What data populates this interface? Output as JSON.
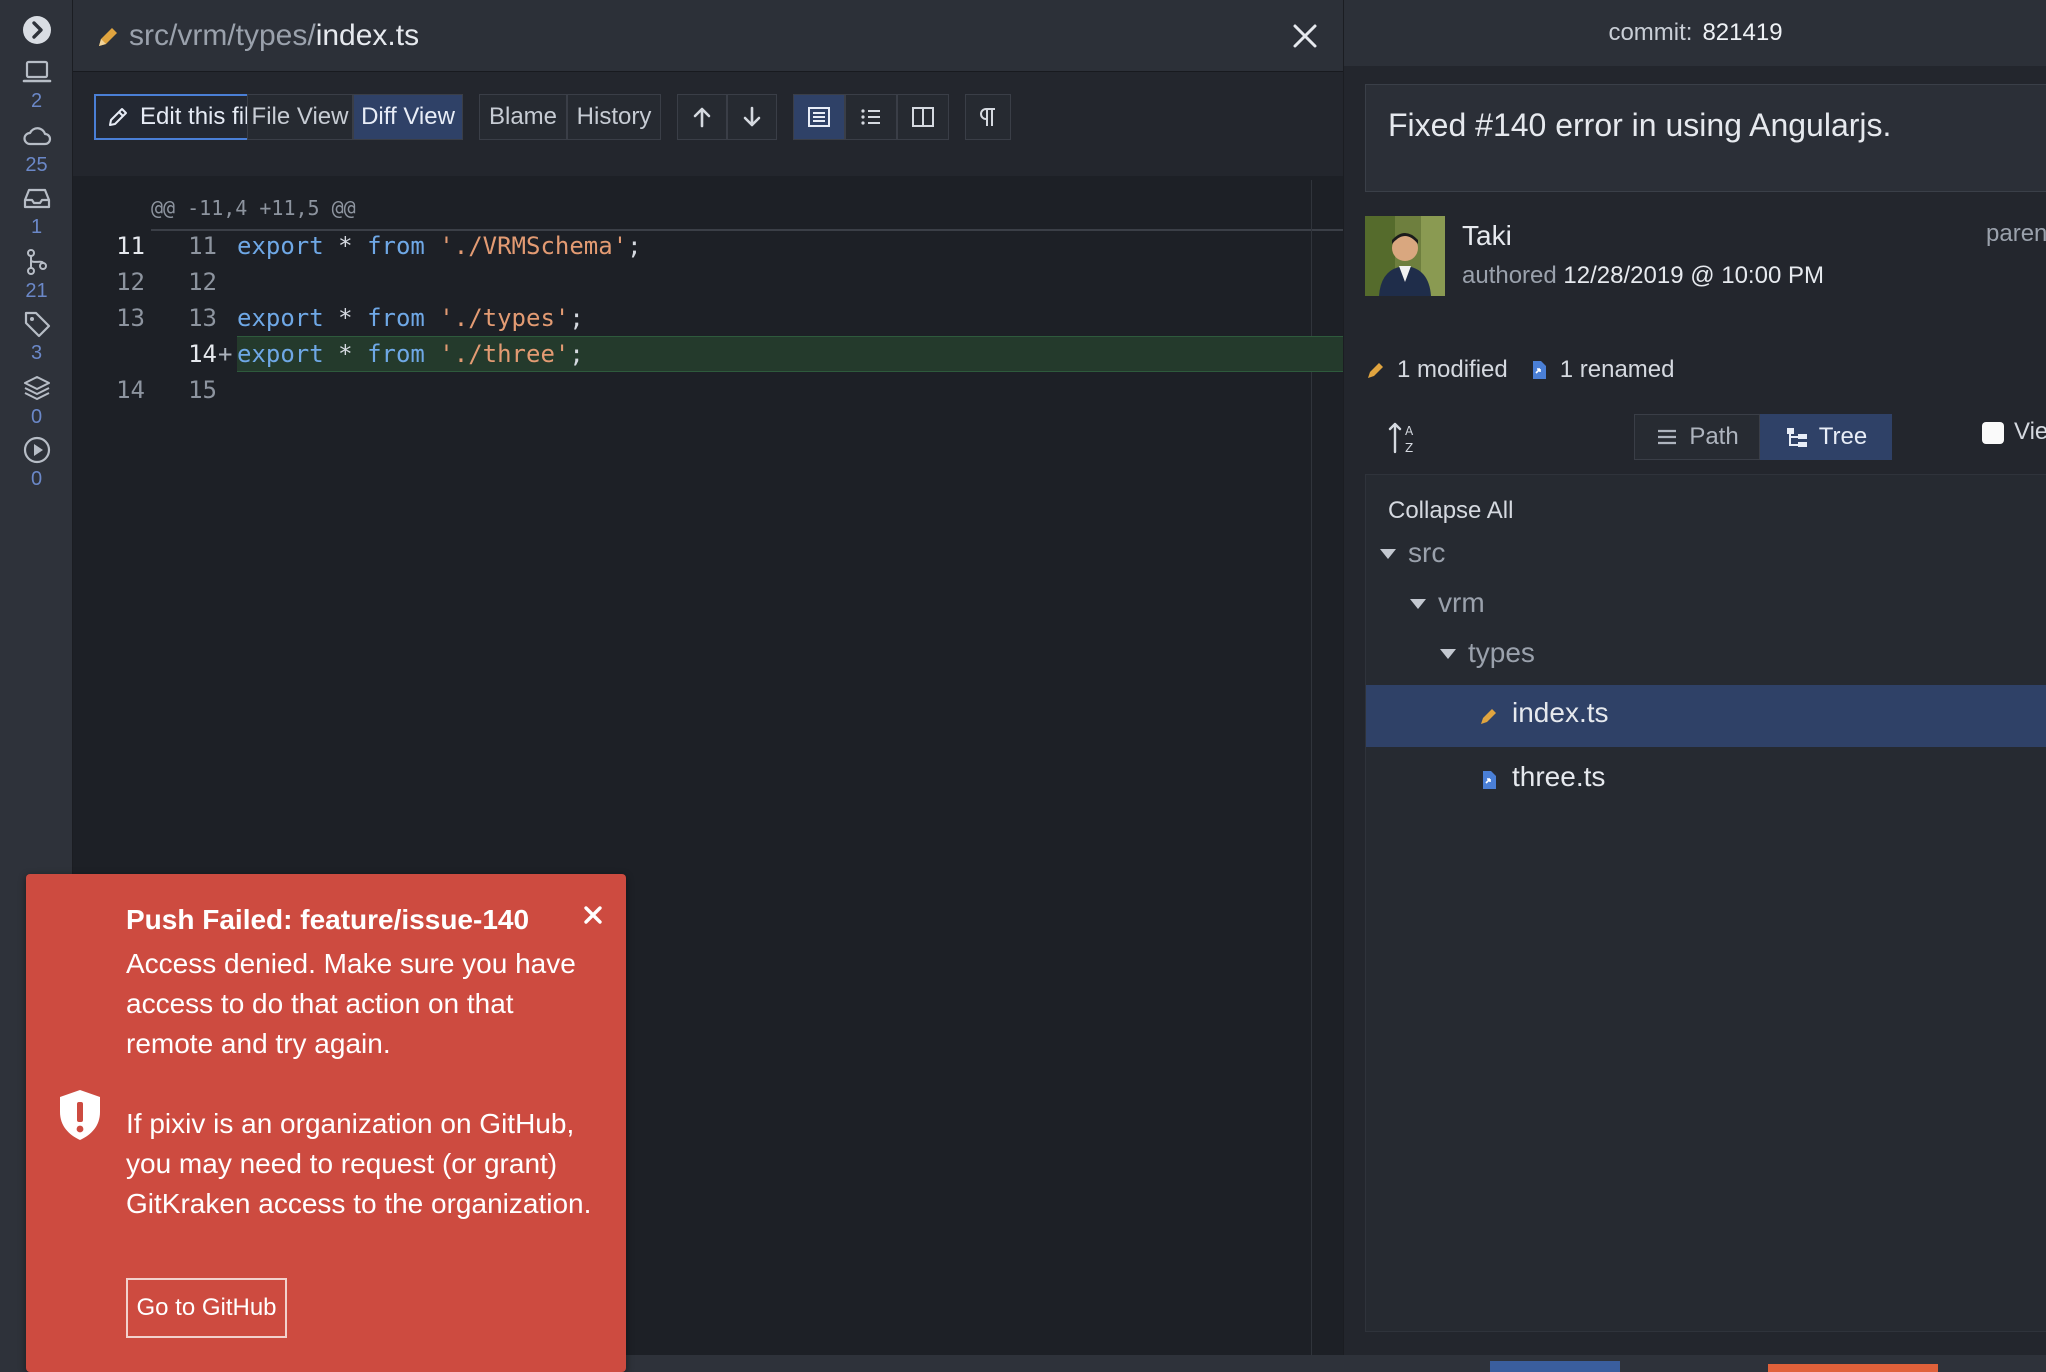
{
  "rail": {
    "items": [
      {
        "icon": "chevron-right-circle-icon",
        "count": ""
      },
      {
        "icon": "laptop-icon",
        "count": "2"
      },
      {
        "icon": "cloud-icon",
        "count": "25"
      },
      {
        "icon": "inbox-icon",
        "count": "1"
      },
      {
        "icon": "pull-request-icon",
        "count": "21"
      },
      {
        "icon": "tag-icon",
        "count": "3"
      },
      {
        "icon": "layers-icon",
        "count": "0"
      },
      {
        "icon": "play-circle-icon",
        "count": "0"
      }
    ]
  },
  "diff": {
    "path_dir": "src/vrm/types/",
    "path_file": "index.ts",
    "toolbar": {
      "edit": "Edit this file",
      "file_view": "File View",
      "diff_view": "Diff View",
      "blame": "Blame",
      "history": "History"
    },
    "hunk_header": "@@ -11,4 +11,5 @@",
    "lines": [
      {
        "old": "11",
        "new": "11",
        "mark": "",
        "kw1": "export",
        "op": " * ",
        "kw2": "from",
        "str": " './VRMSchema'",
        "end": ";"
      },
      {
        "old": "12",
        "new": "12",
        "mark": "",
        "kw1": "",
        "op": "",
        "kw2": "",
        "str": "",
        "end": ""
      },
      {
        "old": "13",
        "new": "13",
        "mark": "",
        "kw1": "export",
        "op": " * ",
        "kw2": "from",
        "str": " './types'",
        "end": ";"
      },
      {
        "old": "",
        "new": "14",
        "mark": "+",
        "kw1": "export",
        "op": " * ",
        "kw2": "from",
        "str": " './three'",
        "end": ";"
      },
      {
        "old": "14",
        "new": "15",
        "mark": "",
        "kw1": "",
        "op": "",
        "kw2": "",
        "str": "",
        "end": ""
      }
    ]
  },
  "commit": {
    "label": "commit:",
    "sha": "821419",
    "message": "Fixed #140 error in using Angularjs.",
    "author": "Taki",
    "authored_label": "authored",
    "date": "12/28/2019 @ 10:00 PM",
    "parent_label": "paren",
    "modified": "1 modified",
    "renamed": "1 renamed",
    "path_label": "Path",
    "tree_label": "Tree",
    "view_label": "Vie",
    "collapse_all": "Collapse All",
    "tree": {
      "src": "src",
      "vrm": "vrm",
      "types": "types",
      "file1": "index.ts",
      "file2": "three.ts"
    }
  },
  "toast": {
    "title": "Push Failed: feature/issue-140",
    "body1": "Access denied. Make sure you have access to do that action on that remote and try again.",
    "body2": "If pixiv is an organization on GitHub, you may need to request (or grant) GitKraken access to the organization.",
    "button": "Go to GitHub",
    "color": "#cd4b40"
  },
  "colors": {
    "accent": "#2f4167",
    "added_line": "#243a2c",
    "keyword": "#6fa8e6",
    "string": "#e39b73"
  }
}
